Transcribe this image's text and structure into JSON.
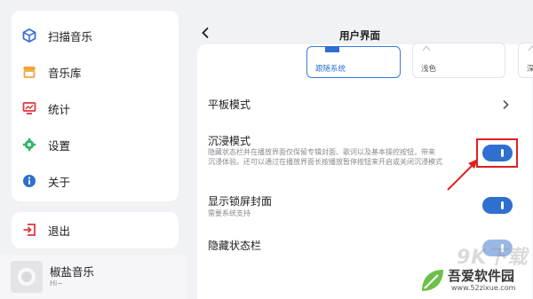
{
  "sidebar": {
    "items": [
      {
        "label": "扫描音乐",
        "icon": "scan-cube-icon"
      },
      {
        "label": "音乐库",
        "icon": "library-icon"
      },
      {
        "label": "统计",
        "icon": "stats-icon"
      },
      {
        "label": "设置",
        "icon": "gear-icon"
      },
      {
        "label": "关于",
        "icon": "info-icon"
      }
    ],
    "logout": {
      "label": "退出",
      "icon": "logout-icon"
    }
  },
  "player": {
    "title": "椒盐音乐",
    "subtitle": "Hi~"
  },
  "settings": {
    "title": "用户界面",
    "theme_options": [
      {
        "label": "跟随系统",
        "selected": true
      },
      {
        "label": "浅色",
        "selected": false
      },
      {
        "label": "深色",
        "selected": false
      }
    ],
    "rows": {
      "tablet": {
        "title": "平板模式"
      },
      "immersive": {
        "title": "沉浸模式",
        "desc_line1": "隐藏状态栏并在播放界面仅保留专辑封面、歌词以及基本操控按钮，带来",
        "desc_line2": "沉浸体验。还可以通过在播放界面长按播放暂停按钮来开启或关闭沉浸模式",
        "enabled": true
      },
      "lockscreen": {
        "title": "显示锁屏封面",
        "desc": "需要系统支持",
        "enabled": true
      },
      "hide_statusbar": {
        "title": "隐藏状态栏"
      }
    }
  },
  "watermark": {
    "big": "9K下载",
    "name": "吾爱软件园",
    "url": "www.52zixue.com"
  },
  "colors": {
    "accent": "#2f6fd0",
    "highlight": "#e02020",
    "background": "#f1f2f6"
  }
}
